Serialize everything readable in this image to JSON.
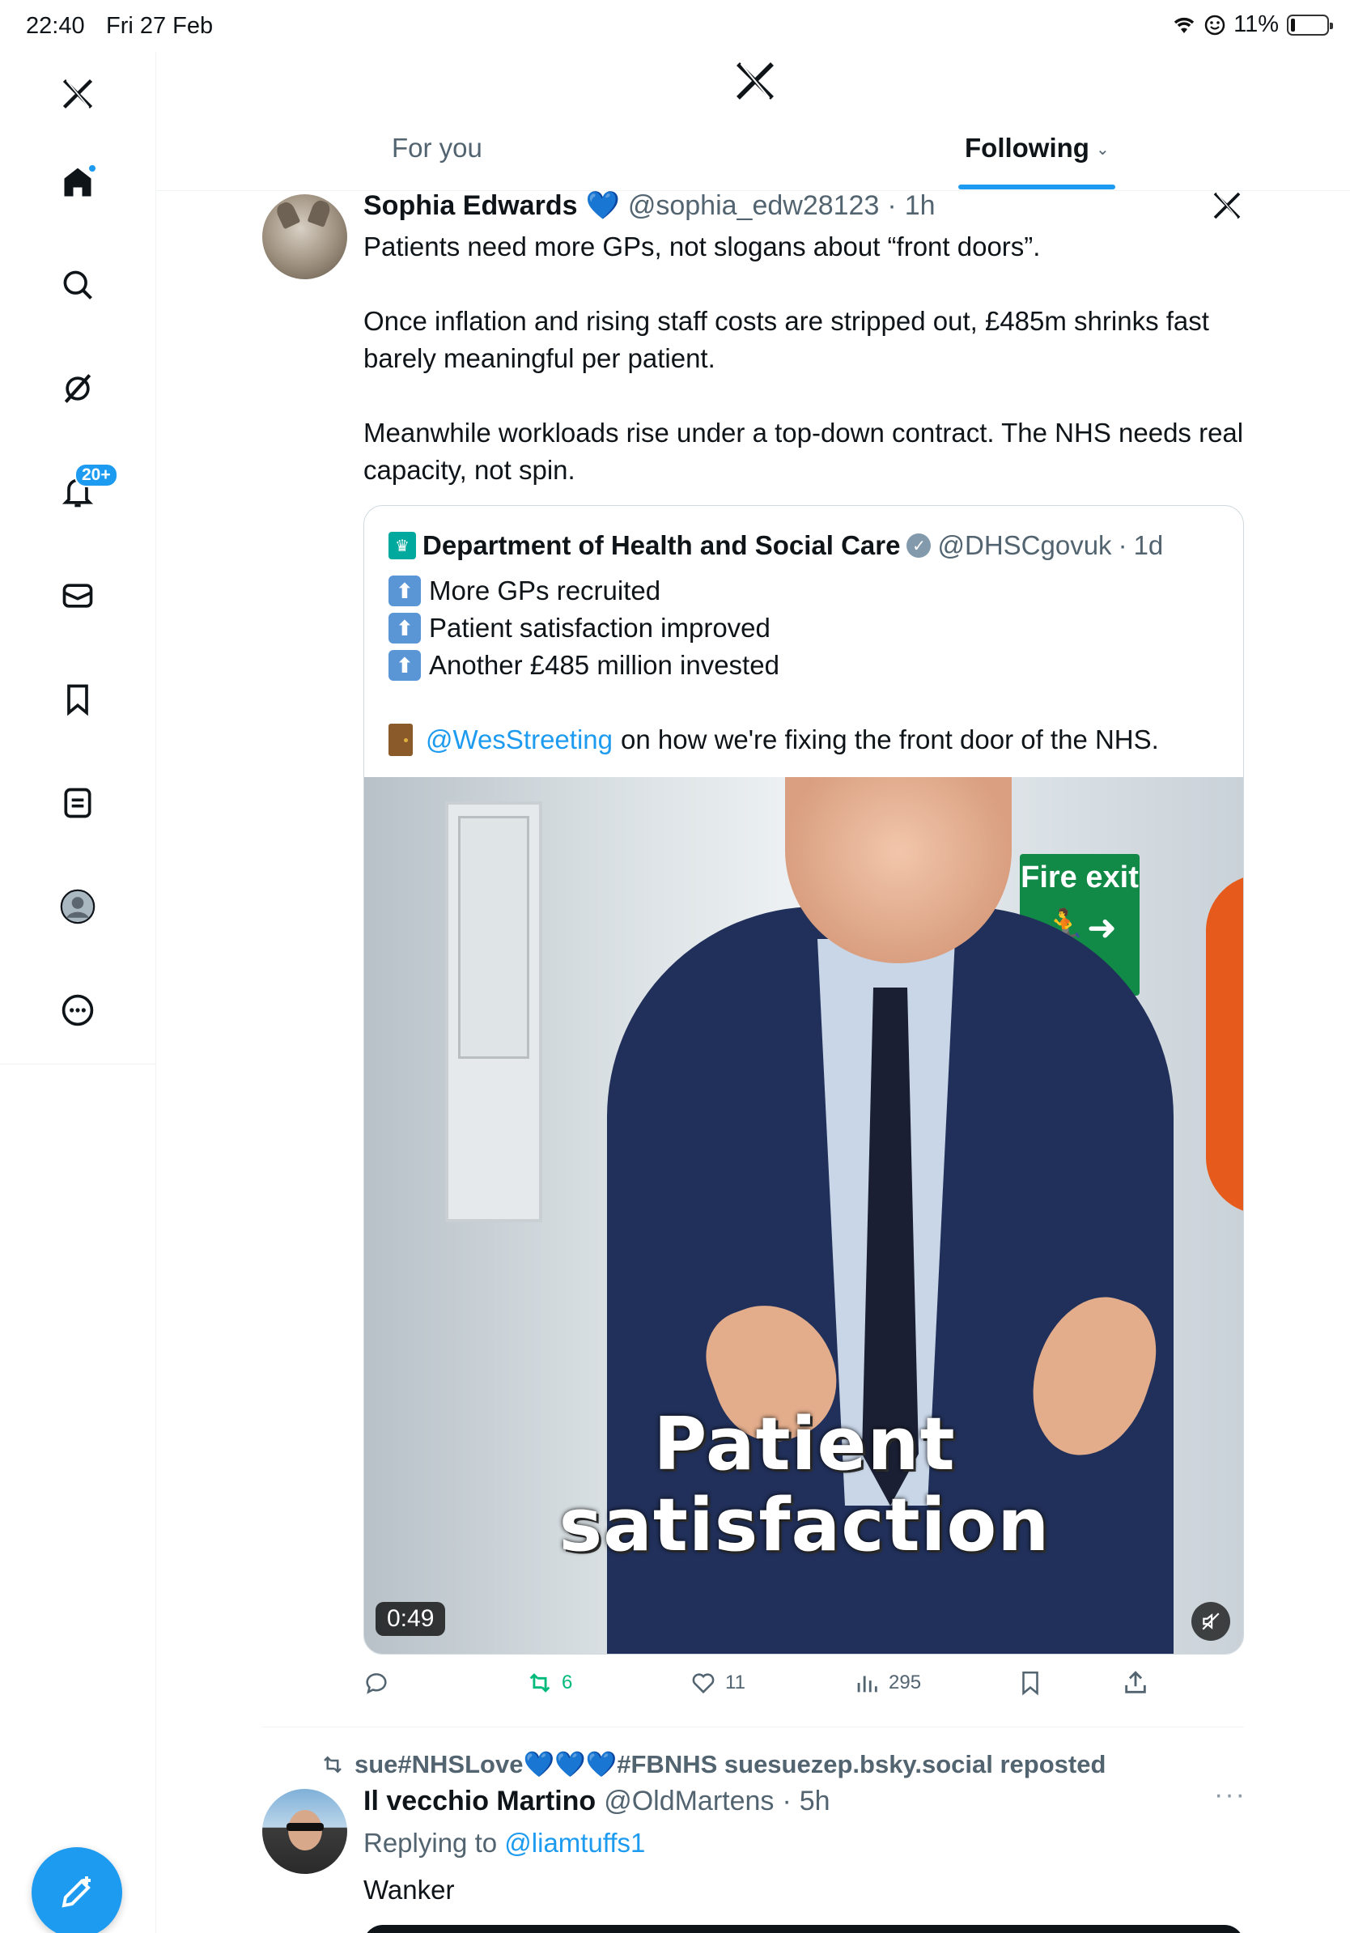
{
  "status_bar": {
    "time": "22:40",
    "date": "Fri 27 Feb",
    "battery": "11%"
  },
  "sidebar": {
    "items": [
      {
        "name": "home"
      },
      {
        "name": "search"
      },
      {
        "name": "grok"
      },
      {
        "name": "notifications",
        "badge": "20+"
      },
      {
        "name": "messages"
      },
      {
        "name": "bookmarks"
      },
      {
        "name": "lists"
      },
      {
        "name": "profile"
      },
      {
        "name": "more"
      }
    ]
  },
  "header": {
    "tabs": [
      {
        "label": "For you"
      },
      {
        "label": "Following"
      }
    ]
  },
  "tweet1": {
    "name": "Sophia Edwards",
    "heart": "💙",
    "handle": "@sophia_edw28123",
    "dot": "·",
    "time": "1h",
    "body": [
      "Patients need more GPs, not slogans about “front doors”.",
      "Once inflation and rising staff costs are stripped out, £485m shrinks fast barely meaningful per patient.",
      "Meanwhile workloads rise under a top-down contract. The NHS needs real capacity, not spin."
    ],
    "quote": {
      "name": "Department of Health and Social Care",
      "handle": "@DHSCgovuk",
      "dot": "·",
      "time": "1d",
      "lines": [
        "More GPs recruited",
        "Patient satisfaction improved",
        "Another £485 million invested"
      ],
      "mention": "@WesStreeting",
      "mention_rest": "on how we're fixing the front door of the NHS.",
      "video": {
        "caption_line1": "Patient",
        "caption_line2": "satisfaction",
        "sign": "Fire exit",
        "duration": "0:49"
      }
    },
    "stats": {
      "retweets": "6",
      "likes": "11",
      "views": "295"
    }
  },
  "tweet2": {
    "reposted_by": "sue#NHSLove💙💙💙#FBNHS suesuezep.bsky.social reposted",
    "name": "Il vecchio Martino",
    "handle": "@OldMartens",
    "dot": "·",
    "time": "5h",
    "replying_label": "Replying to",
    "replying_to": "@liamtuffs1",
    "body": "Wanker",
    "more": "···"
  },
  "colors": {
    "accent": "#1d9bf0",
    "text": "#0f1419",
    "secondary": "#536471",
    "retweet": "#00ba7c"
  }
}
